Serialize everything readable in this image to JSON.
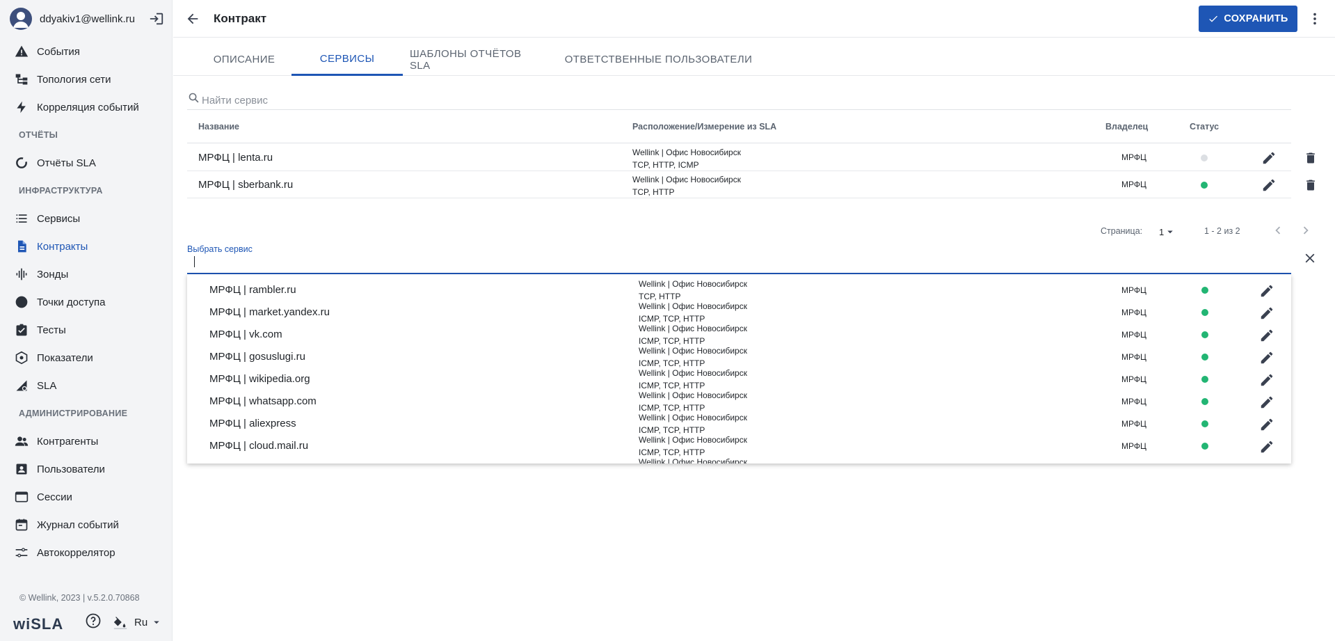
{
  "user": {
    "email": "ddyakiv1@wellink.ru"
  },
  "sidebar": {
    "items_top": [
      {
        "label": "События",
        "icon": "warning-icon"
      },
      {
        "label": "Топология сети",
        "icon": "topology-icon"
      },
      {
        "label": "Корреляция событий",
        "icon": "bolt-icon"
      }
    ],
    "section_reports": "ОТЧЁТЫ",
    "items_reports": [
      {
        "label": "Отчёты SLA",
        "icon": "circle-progress-icon"
      }
    ],
    "section_infra": "ИНФРАСТРУКТУРА",
    "items_infra": [
      {
        "label": "Сервисы",
        "icon": "list-icon"
      },
      {
        "label": "Контракты",
        "icon": "document-icon"
      },
      {
        "label": "Зонды",
        "icon": "probe-icon"
      },
      {
        "label": "Точки доступа",
        "icon": "dot-icon"
      },
      {
        "label": "Тесты",
        "icon": "checklist-icon"
      },
      {
        "label": "Показатели",
        "icon": "metrics-icon"
      },
      {
        "label": "SLA",
        "icon": "sla-icon"
      }
    ],
    "section_admin": "АДМИНИСТРИРОВАНИЕ",
    "items_admin": [
      {
        "label": "Контрагенты",
        "icon": "people-icon"
      },
      {
        "label": "Пользователи",
        "icon": "user-box-icon"
      },
      {
        "label": "Сессии",
        "icon": "window-icon"
      },
      {
        "label": "Журнал событий",
        "icon": "calendar-icon"
      },
      {
        "label": "Автокоррелятор",
        "icon": "sliders-icon"
      }
    ],
    "footer": "© Wellink, 2023 | v.5.2.0.70868",
    "logo": "wiSLA",
    "language": "Ru"
  },
  "header": {
    "title": "Контракт",
    "save_label": "СОХРАНИТЬ"
  },
  "tabs": [
    "ОПИСАНИЕ",
    "СЕРВИСЫ",
    "ШАБЛОНЫ ОТЧЁТОВ SLA",
    "ОТВЕТСТВЕННЫЕ ПОЛЬЗОВАТЕЛИ"
  ],
  "search": {
    "placeholder": "Найти сервис"
  },
  "table": {
    "columns": [
      "Название",
      "Расположение/Измерение из SLA",
      "Владелец",
      "Статус"
    ],
    "rows": [
      {
        "name": "МРФЦ | lenta.ru",
        "location": "Wellink | Офис Новосибирск",
        "protocols": "TCP, HTTP, ICMP",
        "owner": "МРФЦ",
        "status": "inactive",
        "status_color": "#dcdfe3"
      },
      {
        "name": "МРФЦ | sberbank.ru",
        "location": "Wellink | Офис Новосибирск",
        "protocols": "TCP, HTTP",
        "owner": "МРФЦ",
        "status": "ok",
        "status_color": "#22b573"
      }
    ]
  },
  "pagination": {
    "label": "Страница:",
    "page": "1",
    "range": "1 - 2 из 2"
  },
  "select_service": {
    "label": "Выбрать сервис",
    "options": [
      {
        "name": "МРФЦ | rambler.ru",
        "location": "Wellink | Офис Новосибирск",
        "protocols": "TCP, HTTP",
        "owner": "МРФЦ"
      },
      {
        "name": "МРФЦ | market.yandex.ru",
        "location": "Wellink | Офис Новосибирск",
        "protocols": "ICMP, TCP, HTTP",
        "owner": "МРФЦ"
      },
      {
        "name": "МРФЦ | vk.com",
        "location": "Wellink | Офис Новосибирск",
        "protocols": "ICMP, TCP, HTTP",
        "owner": "МРФЦ"
      },
      {
        "name": "МРФЦ | gosuslugi.ru",
        "location": "Wellink | Офис Новосибирск",
        "protocols": "ICMP, TCP, HTTP",
        "owner": "МРФЦ"
      },
      {
        "name": "МРФЦ | wikipedia.org",
        "location": "Wellink | Офис Новосибирск",
        "protocols": "ICMP, TCP, HTTP",
        "owner": "МРФЦ"
      },
      {
        "name": "МРФЦ | whatsapp.com",
        "location": "Wellink | Офис Новосибирск",
        "protocols": "ICMP, TCP, HTTP",
        "owner": "МРФЦ"
      },
      {
        "name": "МРФЦ | aliexpress",
        "location": "Wellink | Офис Новосибирск",
        "protocols": "ICMP, TCP, HTTP",
        "owner": "МРФЦ"
      },
      {
        "name": "МРФЦ | cloud.mail.ru",
        "location": "Wellink | Офис Новосибирск",
        "protocols": "ICMP, TCP, HTTP",
        "owner": "МРФЦ"
      },
      {
        "name": "",
        "location": "Wellink | Офис Новосибирск",
        "protocols": "",
        "owner": ""
      }
    ]
  },
  "colors": {
    "accent": "#1e56b5",
    "status_ok": "#22b573",
    "status_inactive": "#dcdfe3"
  }
}
